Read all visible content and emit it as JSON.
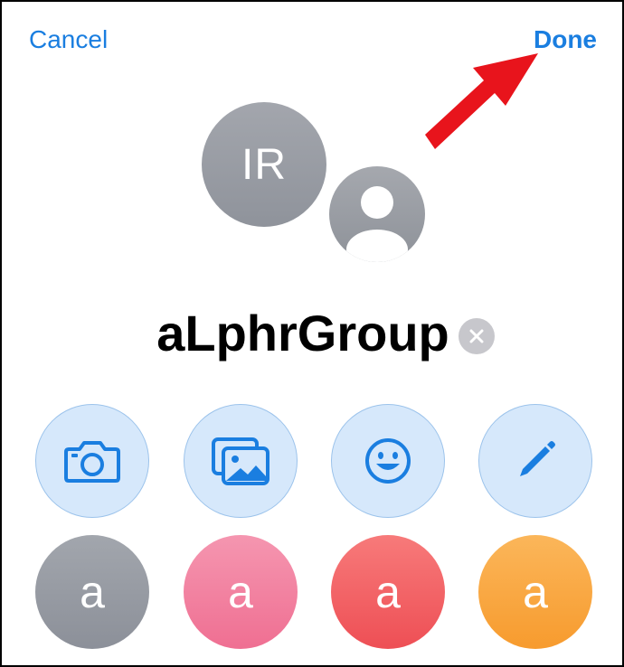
{
  "header": {
    "cancel_label": "Cancel",
    "done_label": "Done"
  },
  "group": {
    "initials": "IR",
    "name": "aLphrGroup"
  },
  "actions": [
    {
      "icon": "camera-icon"
    },
    {
      "icon": "photo-library-icon"
    },
    {
      "icon": "emoji-icon"
    },
    {
      "icon": "pencil-icon"
    }
  ],
  "monograms": [
    {
      "letter": "a",
      "color": "#979ba3"
    },
    {
      "letter": "a",
      "color": "#f2819f"
    },
    {
      "letter": "a",
      "color": "#f26468"
    },
    {
      "letter": "a",
      "color": "#f9a845"
    }
  ],
  "colors": {
    "accent": "#1a7ee0",
    "annotation_arrow": "#e8141c"
  }
}
